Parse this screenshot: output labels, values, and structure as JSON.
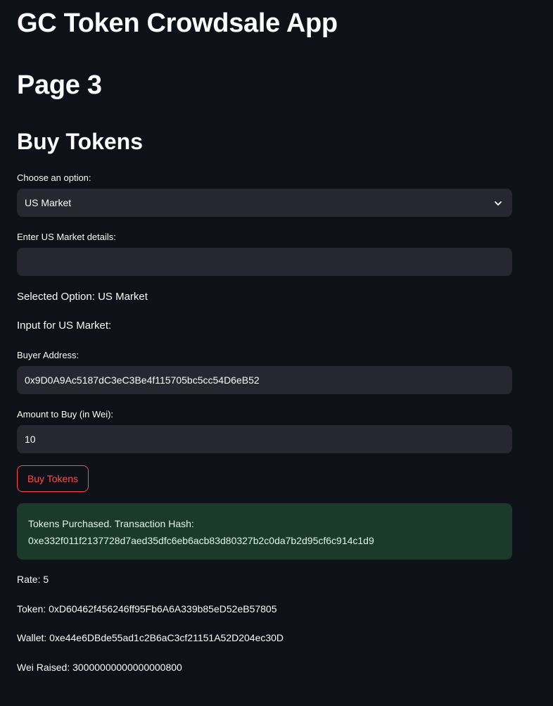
{
  "app": {
    "title": "GC Token Crowdsale App",
    "page_title": "Page 3",
    "section_title": "Buy Tokens"
  },
  "option_select": {
    "label": "Choose an option:",
    "selected": "US Market",
    "icon": "chevron-down-icon"
  },
  "details_input": {
    "label": "Enter US Market details:",
    "value": ""
  },
  "selected_option_text": "Selected Option: US Market",
  "input_for_text": "Input for US Market:",
  "buyer_address": {
    "label": "Buyer Address:",
    "value": "0x9D0A9Ac5187dC3eC3Be4f115705bc5cc54D6eB52"
  },
  "amount": {
    "label": "Amount to Buy (in Wei):",
    "value": "10"
  },
  "buy_button": {
    "label": "Buy Tokens"
  },
  "success": {
    "line1": "Tokens Purchased. Transaction Hash:",
    "hash": "0xe332f011f2137728d7aed35dfc6eb6acb83d80327b2c0da7b2d95cf6c914c1d9"
  },
  "info": {
    "rate": "Rate: 5",
    "token": "Token: 0xD60462f456246ff95Fb6A6A339b85eD52eB57805",
    "wallet": "Wallet: 0xe44e6DBde55ad1c2B6aC3cf21151A52D204ec30D",
    "wei_raised": "Wei Raised: 30000000000000000800"
  },
  "colors": {
    "background": "#0e1117",
    "field": "#262730",
    "accent": "#ff4b4b",
    "success_bg": "#1c3a2a"
  }
}
